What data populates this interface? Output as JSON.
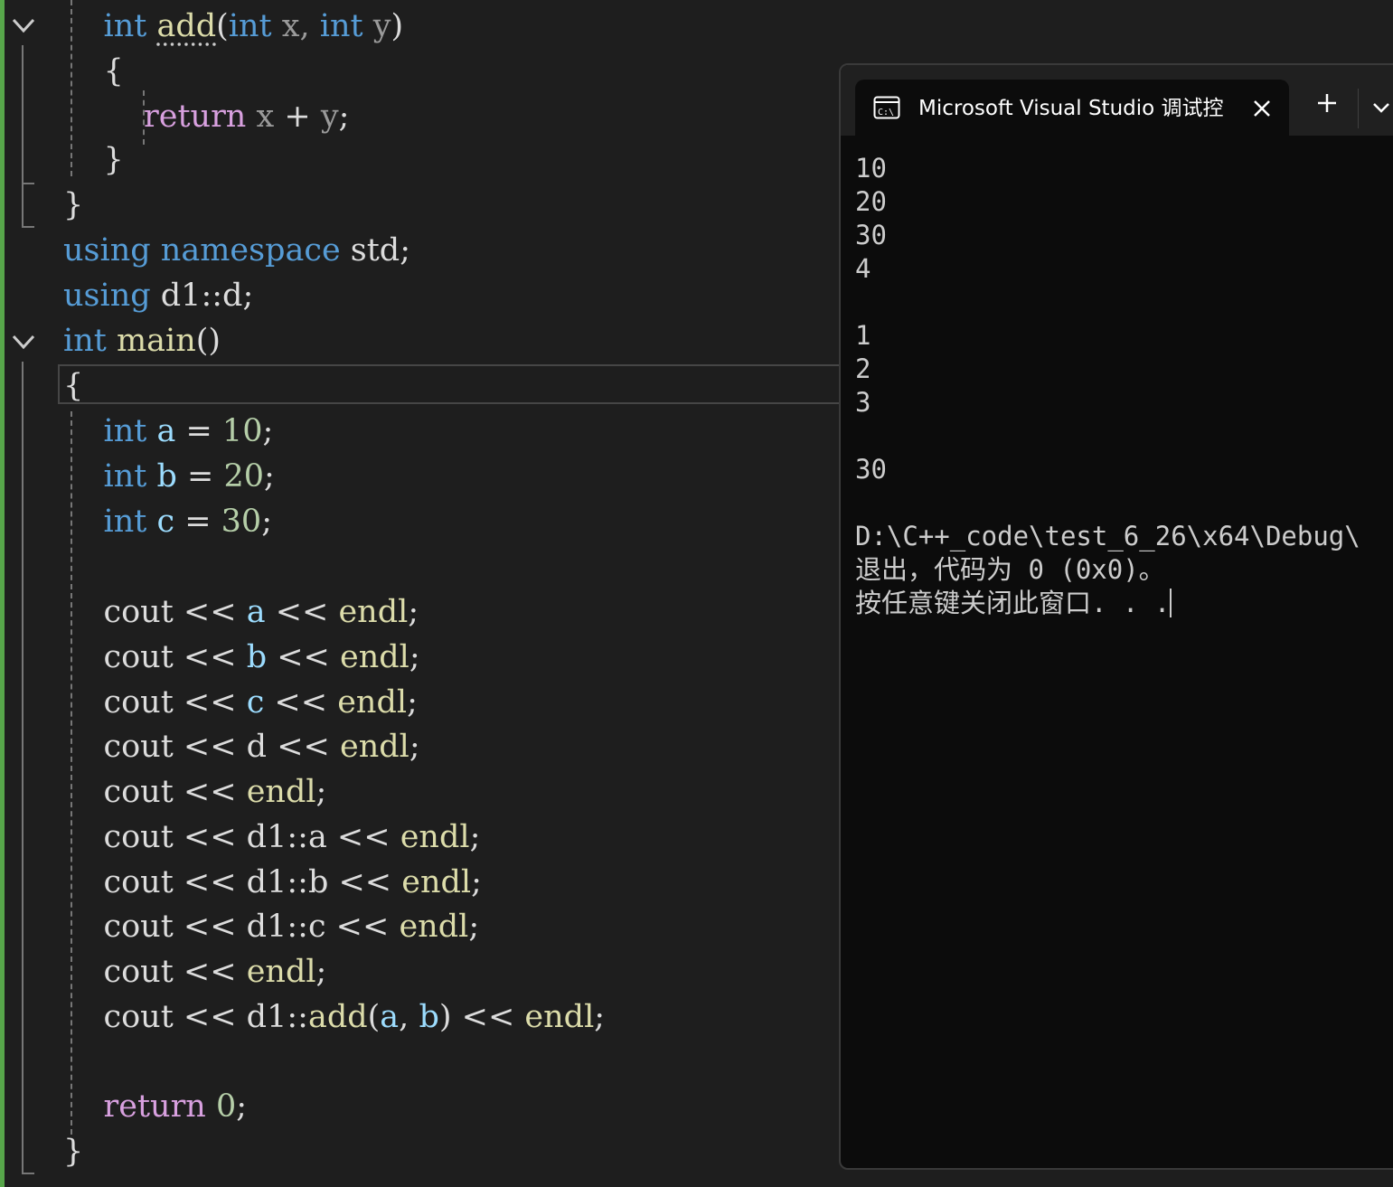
{
  "editor": {
    "lines": [
      [
        {
          "t": "    "
        },
        {
          "t": "int",
          "c": "kw"
        },
        {
          "t": " "
        },
        {
          "t": "add",
          "c": "fn",
          "squiggle": true
        },
        {
          "t": "("
        },
        {
          "t": "int",
          "c": "kw"
        },
        {
          "t": " x, ",
          "c": "param"
        },
        {
          "t": "int",
          "c": "kw"
        },
        {
          "t": " y",
          "c": "param"
        },
        {
          "t": ")"
        }
      ],
      [
        {
          "t": "    {"
        }
      ],
      [
        {
          "t": "        "
        },
        {
          "t": "return",
          "c": "ctl"
        },
        {
          "t": " "
        },
        {
          "t": "x",
          "c": "param"
        },
        {
          "t": " + "
        },
        {
          "t": "y",
          "c": "param"
        },
        {
          "t": ";"
        }
      ],
      [
        {
          "t": "    }"
        }
      ],
      [
        {
          "t": "}"
        }
      ],
      [
        {
          "t": "using",
          "c": "kw"
        },
        {
          "t": " "
        },
        {
          "t": "namespace",
          "c": "kw"
        },
        {
          "t": " std;"
        }
      ],
      [
        {
          "t": "using",
          "c": "kw"
        },
        {
          "t": " d1::d;"
        }
      ],
      [
        {
          "t": "int",
          "c": "kw"
        },
        {
          "t": " "
        },
        {
          "t": "main",
          "c": "fn"
        },
        {
          "t": "()"
        }
      ],
      [
        {
          "t": "{"
        }
      ],
      [
        {
          "t": "    "
        },
        {
          "t": "int",
          "c": "kw"
        },
        {
          "t": " "
        },
        {
          "t": "a",
          "c": "var"
        },
        {
          "t": " = "
        },
        {
          "t": "10",
          "c": "num"
        },
        {
          "t": ";"
        }
      ],
      [
        {
          "t": "    "
        },
        {
          "t": "int",
          "c": "kw"
        },
        {
          "t": " "
        },
        {
          "t": "b",
          "c": "var"
        },
        {
          "t": " = "
        },
        {
          "t": "20",
          "c": "num"
        },
        {
          "t": ";"
        }
      ],
      [
        {
          "t": "    "
        },
        {
          "t": "int",
          "c": "kw"
        },
        {
          "t": " "
        },
        {
          "t": "c",
          "c": "var"
        },
        {
          "t": " = "
        },
        {
          "t": "30",
          "c": "num"
        },
        {
          "t": ";"
        }
      ],
      [],
      [
        {
          "t": "    cout << "
        },
        {
          "t": "a",
          "c": "var"
        },
        {
          "t": " << "
        },
        {
          "t": "endl",
          "c": "fn"
        },
        {
          "t": ";"
        }
      ],
      [
        {
          "t": "    cout << "
        },
        {
          "t": "b",
          "c": "var"
        },
        {
          "t": " << "
        },
        {
          "t": "endl",
          "c": "fn"
        },
        {
          "t": ";"
        }
      ],
      [
        {
          "t": "    cout << "
        },
        {
          "t": "c",
          "c": "var"
        },
        {
          "t": " << "
        },
        {
          "t": "endl",
          "c": "fn"
        },
        {
          "t": ";"
        }
      ],
      [
        {
          "t": "    cout << d << "
        },
        {
          "t": "endl",
          "c": "fn"
        },
        {
          "t": ";"
        }
      ],
      [
        {
          "t": "    cout << "
        },
        {
          "t": "endl",
          "c": "fn"
        },
        {
          "t": ";"
        }
      ],
      [
        {
          "t": "    cout << d1::a << "
        },
        {
          "t": "endl",
          "c": "fn"
        },
        {
          "t": ";"
        }
      ],
      [
        {
          "t": "    cout << d1::b << "
        },
        {
          "t": "endl",
          "c": "fn"
        },
        {
          "t": ";"
        }
      ],
      [
        {
          "t": "    cout << d1::c << "
        },
        {
          "t": "endl",
          "c": "fn"
        },
        {
          "t": ";"
        }
      ],
      [
        {
          "t": "    cout << "
        },
        {
          "t": "endl",
          "c": "fn"
        },
        {
          "t": ";"
        }
      ],
      [
        {
          "t": "    cout << d1::"
        },
        {
          "t": "add",
          "c": "fn"
        },
        {
          "t": "("
        },
        {
          "t": "a",
          "c": "var"
        },
        {
          "t": ", "
        },
        {
          "t": "b",
          "c": "var"
        },
        {
          "t": ") << "
        },
        {
          "t": "endl",
          "c": "fn"
        },
        {
          "t": ";"
        }
      ],
      [],
      [
        {
          "t": "    "
        },
        {
          "t": "return",
          "c": "ctl"
        },
        {
          "t": " "
        },
        {
          "t": "0",
          "c": "num"
        },
        {
          "t": ";"
        }
      ],
      [
        {
          "t": "}"
        }
      ]
    ],
    "colors": {
      "background": "#1e1e1e",
      "keyword": "#569cd6",
      "control": "#d8a0df",
      "function": "#dcdcaa",
      "variable": "#9cdcfe",
      "number": "#b5cea8",
      "gutter_change": "#57a64a"
    }
  },
  "console": {
    "tab_title": "Microsoft Visual Studio 调试控",
    "output": "10\n20\n30\n4\n\n1\n2\n3\n\n30\n\nD:\\C++_code\\test_6_26\\x64\\Debug\\\n退出，代码为 0 (0x0)。\n按任意键关闭此窗口. . .",
    "icons": {
      "tab_icon": "cmd-icon",
      "close": "close-icon",
      "new_tab": "plus-icon",
      "dropdown": "chevron-down-icon"
    }
  }
}
